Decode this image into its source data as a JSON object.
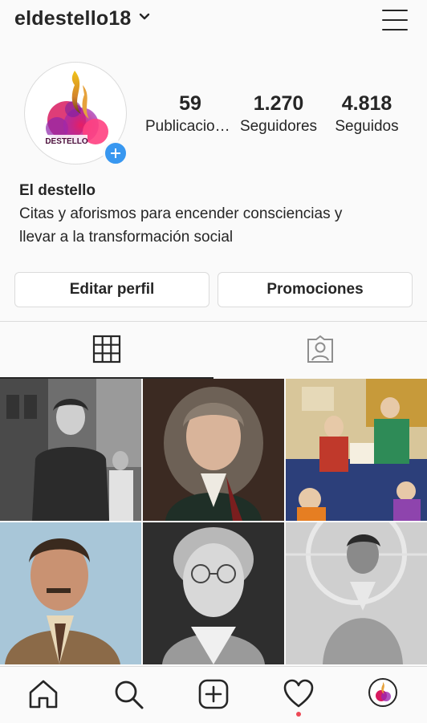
{
  "header": {
    "username": "eldestello18"
  },
  "profile": {
    "avatar_text": "DESTELLO",
    "stats": [
      {
        "num": "59",
        "label": "Publicaciones"
      },
      {
        "num": "1.270",
        "label": "Seguidores"
      },
      {
        "num": "4.818",
        "label": "Seguidos"
      }
    ],
    "name": "El destello",
    "bio_line1": "Citas y aforismos para encender consciencias y",
    "bio_line2": "llevar a la transformación social"
  },
  "buttons": {
    "edit": "Editar perfil",
    "promo": "Promociones"
  },
  "tabs": [
    "grid",
    "tagged"
  ],
  "posts": [
    "woman-in-workwear-photo",
    "man-in-wig-portrait",
    "persian-miniature-painting",
    "man-with-mustache-portrait",
    "elderly-woman-glasses-photo",
    "woman-outdoors-photo"
  ],
  "nav": [
    "home-icon",
    "search-icon",
    "new-post-icon",
    "activity-icon",
    "profile-avatar"
  ],
  "colors": {
    "accent": "#3897f0",
    "notification": "#ed4956"
  }
}
